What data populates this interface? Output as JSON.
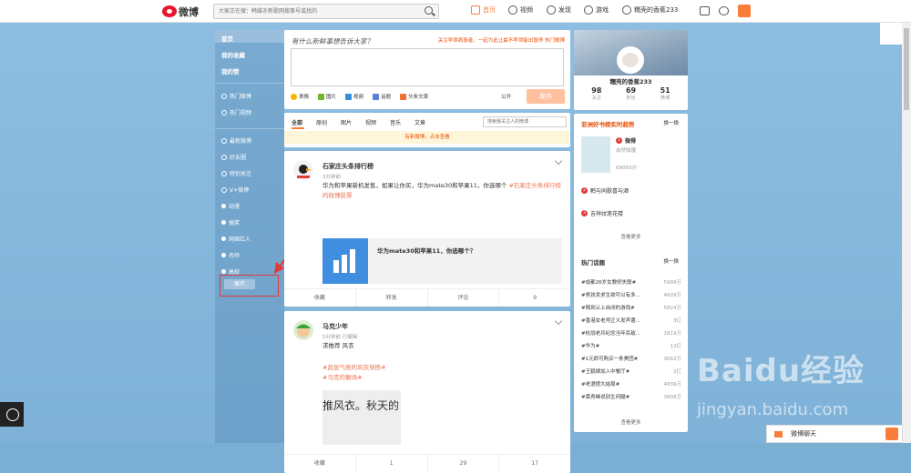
{
  "logo": {
    "text": "微博"
  },
  "search": {
    "placeholder": "大家正在搜：韩媒亦新歌网搜事号或找的"
  },
  "topnav": {
    "home": "首页",
    "video": "视频",
    "discover": "发现",
    "game": "游戏",
    "user": "糯壳的香蕉233"
  },
  "sidebar": {
    "items": [
      {
        "label": "首页"
      },
      {
        "label": "我的收藏"
      },
      {
        "label": "我的赞"
      },
      {
        "label": "热门微博"
      },
      {
        "label": "热门视频"
      },
      {
        "label": "最新微博"
      },
      {
        "label": "好友圈"
      },
      {
        "label": "特别关注"
      },
      {
        "label": "V+微博"
      },
      {
        "label": "动漫"
      },
      {
        "label": "搞笑"
      },
      {
        "label": "网络红人"
      },
      {
        "label": "名师"
      },
      {
        "label": "高校"
      }
    ],
    "expand": "展开"
  },
  "publish": {
    "title": "有什么新鲜事想告诉大家？",
    "hot": "关注早泄病患者，一起为此让最不早泄能出暂停 热门微博",
    "tools": [
      "表情",
      "图片",
      "视频",
      "话题",
      "头条文章"
    ],
    "visibility": "公开",
    "button": "发布"
  },
  "tabs": {
    "items": [
      "全部",
      "原创",
      "图片",
      "视频",
      "音乐",
      "文章"
    ],
    "search_placeholder": "搜索我关注人的微博",
    "notice": "有新微博，点击查看"
  },
  "feed": [
    {
      "name": "石家庄头条排行榜",
      "time": "3分钟前",
      "text": "华为和苹果新机发售，如果让你买，华为mate30和苹果11，你选哪个",
      "link": "#石家庄头条排行榜的微博投票",
      "card_title": "华为mate30和苹果11，你选哪个？",
      "actions": [
        "收藏",
        "转发",
        "评论",
        "9"
      ]
    },
    {
      "name": "马克少年",
      "time": "5分钟前 已编辑",
      "text": "求推荐 风衣",
      "tags": [
        "#超显气质的风衣穿搭#",
        "#马克的衡场#"
      ],
      "image_text": "推风衣。秋天的",
      "actions": [
        "收藏",
        "1",
        "29",
        "17"
      ]
    }
  ],
  "profile": {
    "name": "糯壳的香蕉233",
    "stats": [
      {
        "n": "98",
        "l": "关注"
      },
      {
        "n": "69",
        "l": "粉丝"
      },
      {
        "n": "51",
        "l": "微博"
      }
    ]
  },
  "trend": {
    "title": "亚洲好书榜实时趋势",
    "change": "换一换",
    "book_title": "微得",
    "book_sub": "自然知疆",
    "book_count": "69050分",
    "ranks": [
      {
        "n": "2",
        "t": "鹌与同歌喜与酒"
      },
      {
        "n": "3",
        "t": "吉祥纹莲花楼"
      }
    ],
    "more": "查看更多"
  },
  "hot": {
    "title": "热门话题",
    "change": "换一换",
    "rows": [
      {
        "t": "#成都26岁女教师失联#",
        "c": "5999万"
      },
      {
        "t": "#男孩发求生欲可以有多...",
        "c": "4609万"
      },
      {
        "t": "#随到认上自闭的游戏#",
        "c": "5824万"
      },
      {
        "t": "#香港女老师正义发声遭...",
        "c": "3亿"
      },
      {
        "t": "#杭战老兵纪念当年杀敌...",
        "c": "1819万"
      },
      {
        "t": "#华为#",
        "c": "12亿"
      },
      {
        "t": "#1元即可购买一条美团#",
        "c": "3062万"
      },
      {
        "t": "#王鹤棣加入中餐厅#",
        "c": "2亿"
      },
      {
        "t": "#老酒馆大结局#",
        "c": "4939万"
      },
      {
        "t": "#黄青峰说别生闷腿#",
        "c": "3608万"
      }
    ],
    "more": "查看更多"
  },
  "chat": {
    "label": "微博聊天"
  },
  "watermark": {
    "main": "Baidu经验",
    "sub": "jingyan.baidu.com"
  },
  "colors": {
    "accent": "#fa7d3c",
    "highlight": "#e13a3a"
  }
}
